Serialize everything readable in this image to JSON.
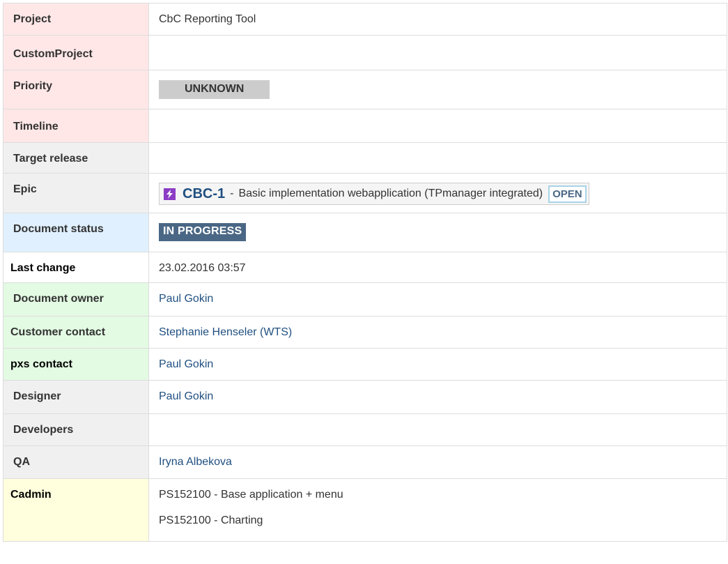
{
  "rows": {
    "project": {
      "label": "Project",
      "value": "CbC Reporting Tool"
    },
    "custom_project": {
      "label": "CustomProject",
      "value": ""
    },
    "priority": {
      "label": "Priority",
      "value": "UNKNOWN"
    },
    "timeline": {
      "label": "Timeline",
      "value": ""
    },
    "target_release": {
      "label": "Target release",
      "value": ""
    },
    "epic": {
      "label": "Epic",
      "key": "CBC-1",
      "separator": "-",
      "summary": "Basic implementation webapplication (TPmanager integrated)",
      "status": "OPEN",
      "icon": "epic-lightning-icon"
    },
    "document_status": {
      "label": "Document status",
      "value": "IN PROGRESS"
    },
    "last_change": {
      "label": "Last change",
      "value": "23.02.2016 03:57"
    },
    "document_owner": {
      "label": "Document owner",
      "value": "Paul Gokin"
    },
    "customer_contact": {
      "label": "Customer contact",
      "value": "Stephanie Henseler (WTS)"
    },
    "pxs_contact": {
      "label": "pxs contact",
      "value": "Paul Gokin"
    },
    "designer": {
      "label": "Designer",
      "value": "Paul Gokin"
    },
    "developers": {
      "label": "Developers",
      "value": ""
    },
    "qa": {
      "label": "QA",
      "value": "Iryna Albekova"
    },
    "cadmin": {
      "label": "Cadmin",
      "values": [
        "PS152100 - Base application + menu",
        "PS152100 - Charting"
      ]
    }
  },
  "colors": {
    "pink": "#ffe7e7",
    "grey": "#f0f0f0",
    "blue": "#e0f0ff",
    "green": "#e3fae3",
    "yellow": "#ffffdd",
    "link": "#205081",
    "status_blue": "#4a6785",
    "epic_purple": "#8b3dc5"
  }
}
